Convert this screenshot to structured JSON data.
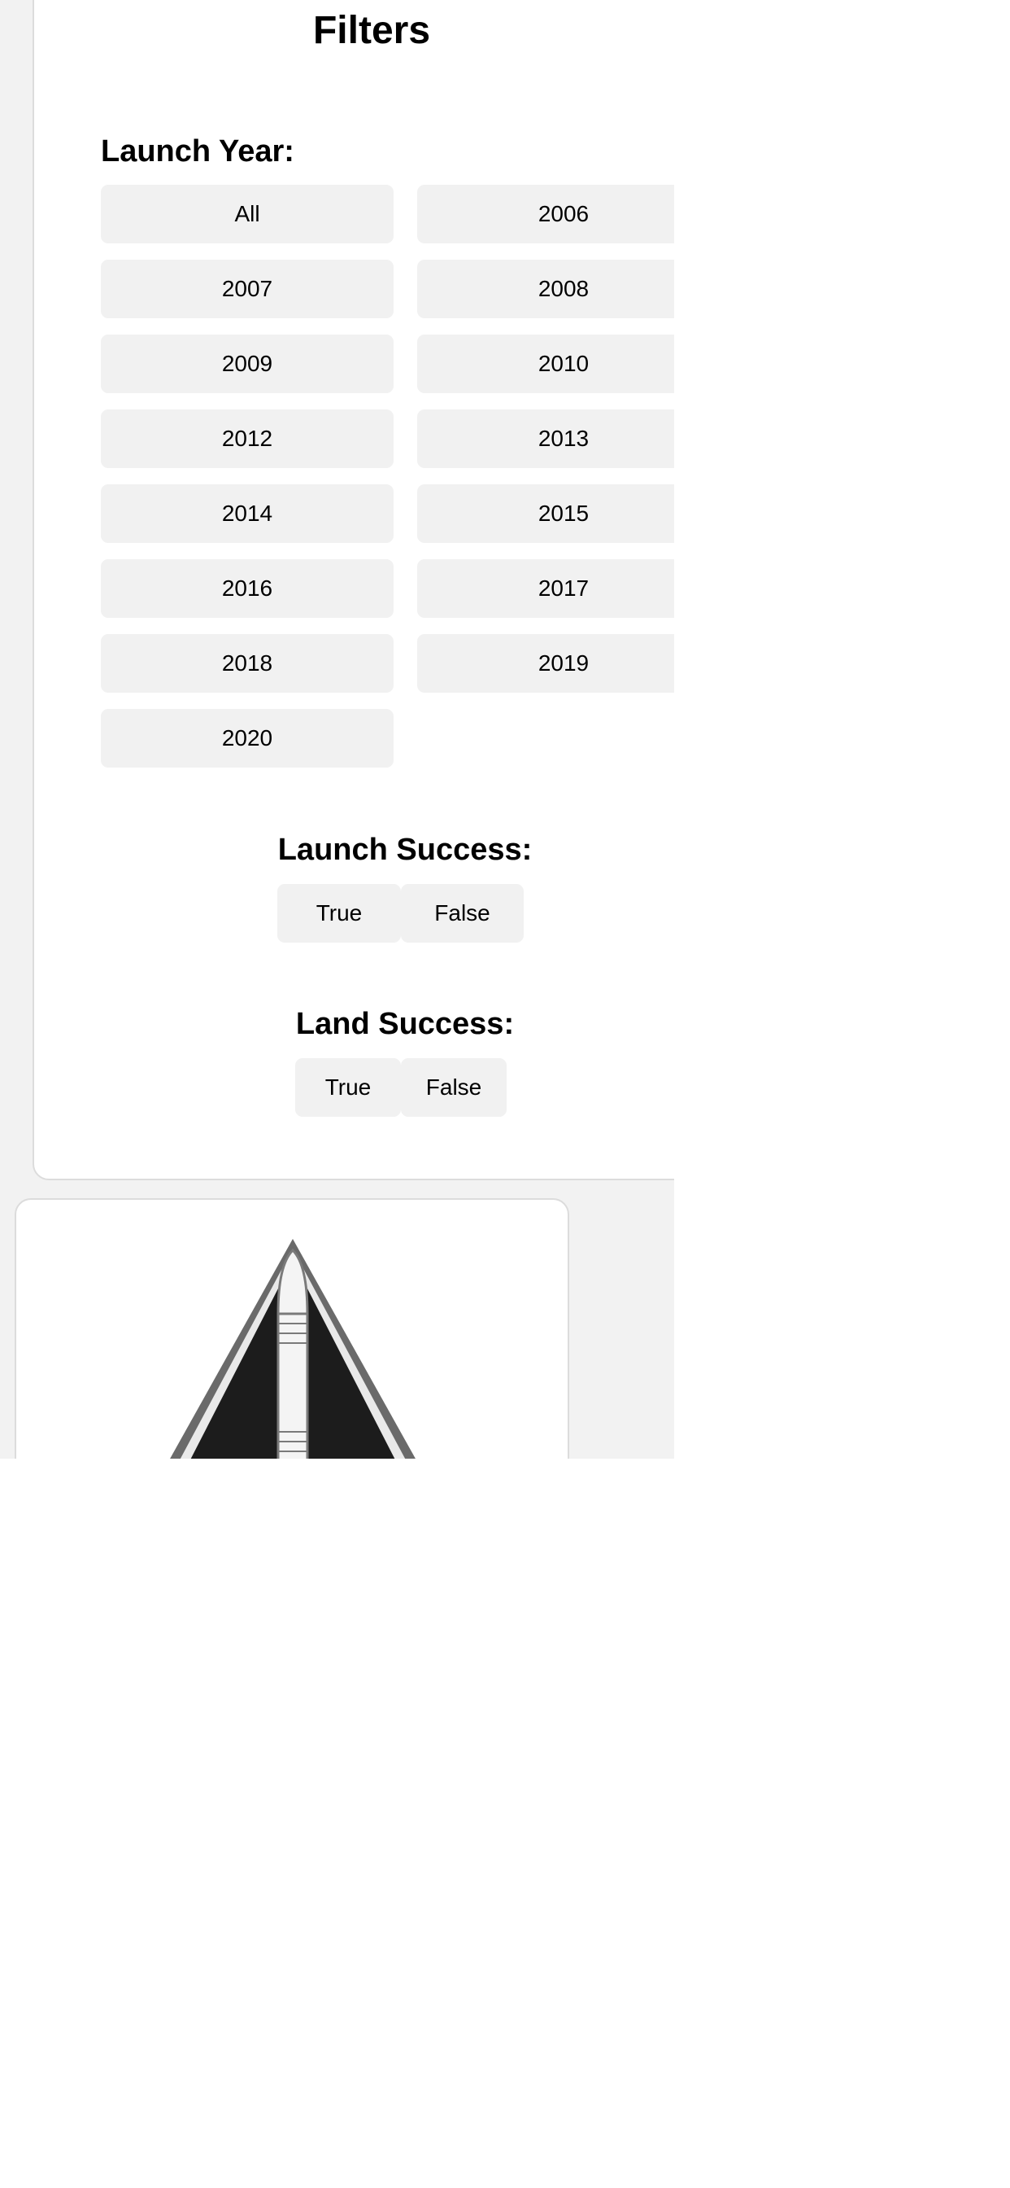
{
  "filters": {
    "title": "Filters",
    "launch_year": {
      "label": "Launch Year:",
      "options": [
        "All",
        "2006",
        "2007",
        "2008",
        "2009",
        "2010",
        "2012",
        "2013",
        "2014",
        "2015",
        "2016",
        "2017",
        "2018",
        "2019",
        "2020"
      ]
    },
    "launch_success": {
      "label": "Launch Success:",
      "options": [
        "True",
        "False"
      ]
    },
    "land_success": {
      "label": "Land Success:",
      "options": [
        "True",
        "False"
      ]
    }
  },
  "launch_card": {
    "image_icon": "rocket-mission-patch-icon"
  },
  "colors": {
    "page_background": "#f2f2f2",
    "card_background": "#ffffff",
    "button_background": "#f1f1f1",
    "card_border": "#dcdcdc",
    "text": "#000000"
  }
}
